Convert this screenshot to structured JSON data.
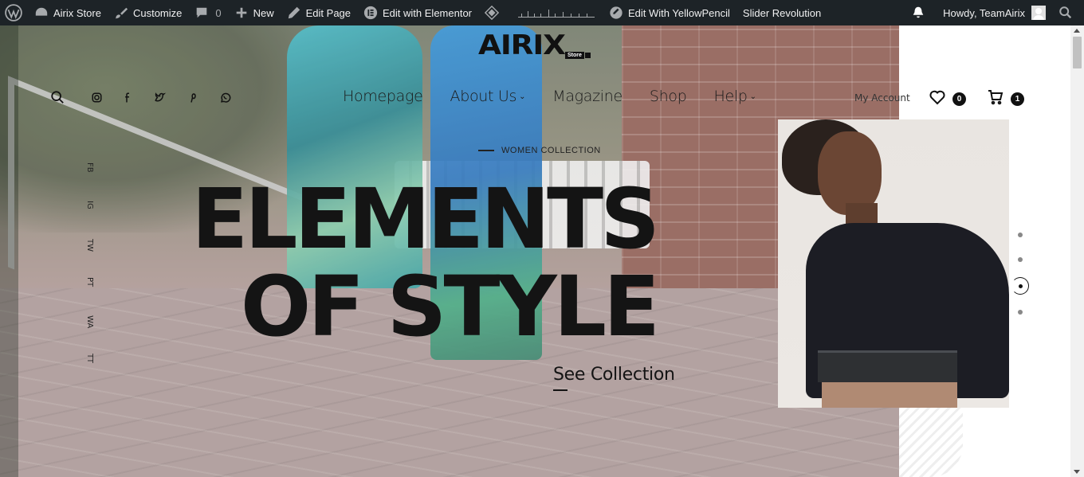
{
  "adminbar": {
    "site_name": "Airix Store",
    "customize": "Customize",
    "comments_count": "0",
    "new": "New",
    "edit_page": "Edit Page",
    "edit_elementor": "Edit with Elementor",
    "edit_yellowpencil": "Edit With YellowPencil",
    "slider_revolution": "Slider Revolution",
    "howdy": "Howdy, TeamAirix"
  },
  "logo": {
    "text": "AIRIX",
    "tag": "Store"
  },
  "nav": {
    "items": [
      {
        "label": "Homepage"
      },
      {
        "label": "About Us"
      },
      {
        "label": "Magazine"
      },
      {
        "label": "Shop"
      },
      {
        "label": "Help"
      }
    ]
  },
  "account": {
    "my_account": "My Account",
    "wishlist_count": "0",
    "cart_count": "1"
  },
  "hero": {
    "eyebrow": "WOMEN COLLECTION",
    "line1": "ELEMENTS",
    "line2": "OF STYLE",
    "cta": "See Collection"
  },
  "social_vertical": [
    "FB",
    "IG",
    "TW",
    "PT",
    "WA",
    "TT"
  ],
  "slider": {
    "slides": 4,
    "active_index": 2
  },
  "colors": {
    "adminbar_bg": "#1d2327",
    "text_dark": "#141414",
    "accent": "#111111"
  }
}
